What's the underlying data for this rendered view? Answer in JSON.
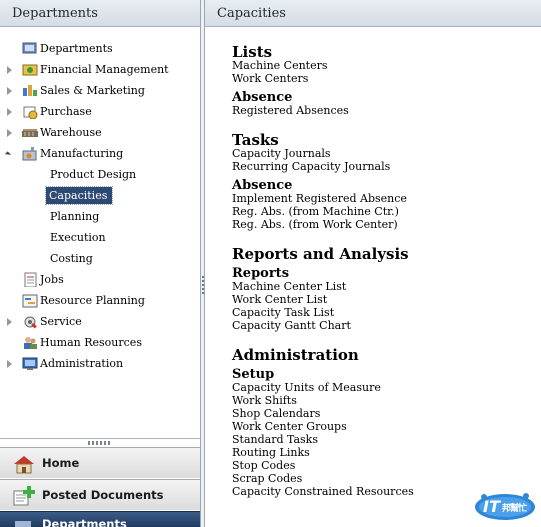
{
  "left_pane": {
    "title": "Departments",
    "tree": [
      {
        "label": "Departments",
        "icon": "departments-icon",
        "expander": "none"
      },
      {
        "label": "Financial Management",
        "icon": "financial-management-icon",
        "expander": "collapsed"
      },
      {
        "label": "Sales & Marketing",
        "icon": "sales-marketing-icon",
        "expander": "collapsed"
      },
      {
        "label": "Purchase",
        "icon": "purchase-icon",
        "expander": "collapsed"
      },
      {
        "label": "Warehouse",
        "icon": "warehouse-icon",
        "expander": "collapsed"
      },
      {
        "label": "Manufacturing",
        "icon": "manufacturing-icon",
        "expander": "expanded",
        "children": [
          "Product Design",
          "Capacities",
          "Planning",
          "Execution",
          "Costing"
        ],
        "selected_child": "Capacities"
      },
      {
        "label": "Jobs",
        "icon": "jobs-icon",
        "expander": "none"
      },
      {
        "label": "Resource Planning",
        "icon": "resource-planning-icon",
        "expander": "none"
      },
      {
        "label": "Service",
        "icon": "service-icon",
        "expander": "collapsed"
      },
      {
        "label": "Human Resources",
        "icon": "human-resources-icon",
        "expander": "none"
      },
      {
        "label": "Administration",
        "icon": "administration-icon",
        "expander": "collapsed"
      }
    ]
  },
  "nav_buttons": [
    {
      "label": "Home",
      "icon": "home-icon"
    },
    {
      "label": "Posted Documents",
      "icon": "posted-documents-icon"
    },
    {
      "label": "Departments",
      "icon": "departments-nav-icon",
      "active": true
    }
  ],
  "right_pane": {
    "title": "Capacities",
    "sections": [
      {
        "title": "Lists",
        "groups": [
          {
            "title": "",
            "items": [
              "Machine Centers",
              "Work Centers"
            ]
          },
          {
            "title": "Absence",
            "items": [
              "Registered Absences"
            ]
          }
        ]
      },
      {
        "title": "Tasks",
        "groups": [
          {
            "title": "",
            "items": [
              "Capacity Journals",
              "Recurring Capacity Journals"
            ]
          },
          {
            "title": "Absence",
            "items": [
              "Implement Registered Absence",
              "Reg. Abs. (from Machine Ctr.)",
              "Reg. Abs. (from Work Center)"
            ]
          }
        ]
      },
      {
        "title": "Reports and Analysis",
        "groups": [
          {
            "title": "Reports",
            "items": [
              "Machine Center List",
              "Work Center List",
              "Capacity Task List",
              "Capacity Gantt Chart"
            ]
          }
        ]
      },
      {
        "title": "Administration",
        "groups": [
          {
            "title": "Setup",
            "items": [
              "Capacity Units of Measure",
              "Work Shifts",
              "Shop Calendars",
              "Work Center Groups",
              "Standard Tasks",
              "Routing Links",
              "Stop Codes",
              "Scrap Codes",
              "Capacity Constrained Resources"
            ]
          }
        ]
      }
    ]
  },
  "watermark": {
    "latin": "IT",
    "cjk": "邦幫忙"
  },
  "colors": {
    "selection": "#2d4a74",
    "header": "#dde2ea",
    "nav_active": "#2a4670",
    "logo_blue": "#2f86d6"
  }
}
